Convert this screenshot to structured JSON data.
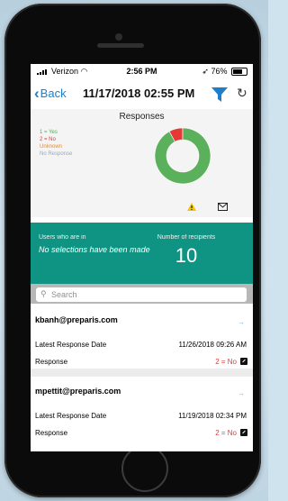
{
  "status": {
    "carrier": "Verizon",
    "time": "2:56 PM",
    "battery": "76%"
  },
  "nav": {
    "back_label": "Back",
    "title": "11/17/2018 02:55 PM"
  },
  "chart_data": {
    "type": "pie",
    "title": "Responses",
    "legend": [
      "1 = Yes",
      "2 = No",
      "Unknown",
      "No Response"
    ],
    "legend_colors": [
      "#4caf50",
      "#e53935",
      "#ef8a21",
      "#9aa7b6"
    ],
    "slices": [
      {
        "name": "1 = Yes",
        "value": 92,
        "color": "#5bb05b"
      },
      {
        "name": "2 = No",
        "value": 8,
        "color": "#e53935"
      }
    ]
  },
  "summary": {
    "users_label": "Users who are in",
    "users_text": "No selections have been made",
    "recipients_label": "Number of recipients",
    "recipients_count": "10"
  },
  "search": {
    "placeholder": "Search"
  },
  "responses": [
    {
      "email": "kbanh@preparis.com",
      "latest_label": "Latest Response Date",
      "latest_value": "11/26/2018 09:26 AM",
      "response_label": "Response",
      "response_value": "2 = No"
    },
    {
      "email": "mpettit@preparis.com",
      "latest_label": "Latest Response Date",
      "latest_value": "11/19/2018 02:34 PM",
      "response_label": "Response",
      "response_value": "2 = No"
    }
  ],
  "colors": {
    "accent": "#1d7fc9",
    "teal": "#0f9483",
    "no_red": "#e23b3b"
  }
}
